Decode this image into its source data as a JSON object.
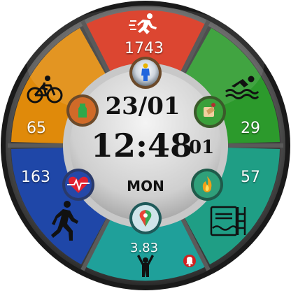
{
  "watchface": {
    "date": "23/01",
    "time": "12:48",
    "seconds": "01",
    "weekday": "MON",
    "segments": {
      "steps": {
        "value": "1743",
        "color": "#d8321a",
        "icon": "running-icon"
      },
      "swim": {
        "value": "29",
        "color": "#2c9a2c",
        "icon": "swimmer-icon"
      },
      "calories": {
        "value": "57",
        "color": "#1f9e85",
        "icon": "pool-icon"
      },
      "distance": {
        "value": "3.83",
        "color": "#1fa09a",
        "icon": "person-arms-up-icon"
      },
      "walk": {
        "value": "163",
        "color": "#1f47a8",
        "icon": "walking-icon"
      },
      "bike": {
        "value": "65",
        "color": "#e08a0a",
        "icon": "bicycle-icon"
      }
    },
    "inner_icons": [
      "walking-person-icon",
      "drink-icon",
      "battery-icon",
      "heart-rate-icon",
      "map-pin-icon",
      "flame-icon",
      "alarm-bell-icon"
    ]
  }
}
